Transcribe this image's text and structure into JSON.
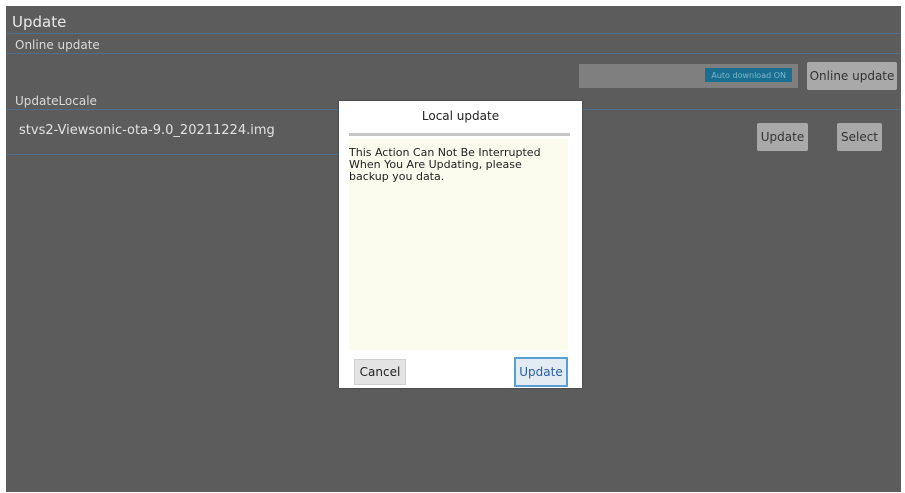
{
  "page": {
    "title": "Update",
    "online_section_label": "Online update",
    "local_section_label": "UpdateLocale",
    "filename": "stvs2-Viewsonic-ota-9.0_20211224.img",
    "auto_download_badge": "Auto download ON",
    "online_update_button": "Online update",
    "update_button": "Update",
    "select_button": "Select"
  },
  "dialog": {
    "title": "Local update",
    "message": "This Action Can Not Be Interrupted When You Are Updating, please backup you data.",
    "cancel_label": "Cancel",
    "update_label": "Update"
  },
  "colors": {
    "overlay_background": "#5c5c5c",
    "divider_line": "#4d6f8c",
    "badge_background": "#1a6f91",
    "dialog_body_background": "#fbfbee",
    "dialog_primary_border": "#58a0d3"
  }
}
